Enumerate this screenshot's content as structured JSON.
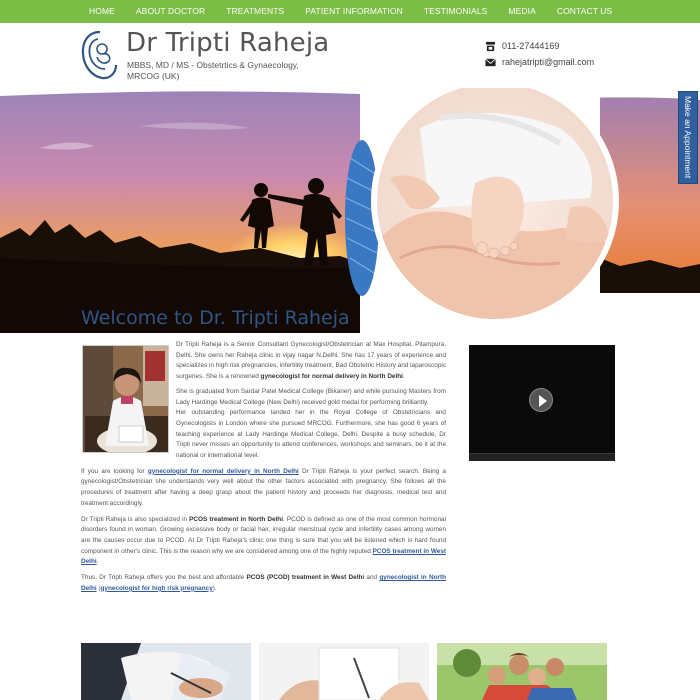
{
  "nav": {
    "items": [
      "HOME",
      "ABOUT DOCTOR",
      "TREATMENTS",
      "PATIENT INFORMATION",
      "TESTIMONIALS",
      "MEDIA",
      "CONTACT US"
    ]
  },
  "header": {
    "name": "Dr Tripti Raheja",
    "qualifications": "MBBS, MD / MS - Obstetrtics & Gynaecology, MRCOG (UK)",
    "phone": "011-27444169",
    "email": "rahejatripti@gmail.com"
  },
  "appointment_tab": "Make an Appointment",
  "main": {
    "title": "Welcome to Dr. Tripti Raheja",
    "p1_a": "Dr Tripti Raheja is a Senior Consultant Gynecologist/Obstetrician at Max Hospital, Pitampura, Delhi. She owns her Raheja clinic in vijay nagar N.Delhi. She has 17 years of experience and specializes in high risk pregnancies, infertility treatment, Bad Obstetric History and laparoscopic surgeries. She is a renowned ",
    "p1_bold": "gynecologist for normal delivery in North Delhi",
    "p1_b": ".",
    "p2": "She is graduated from Sardar Patel Medical College (Bikaner) and while pursuing Masters from Lady Hardinge Medical College (New Delhi) received gold medal for performing brilliantly.",
    "p3": "Her outstanding performance landed her in the Royal College of Obstetricians and Gynecologists in London where she pursued MRCOG. Furthermore, she has good 6 years of teaching experience at Lady Hardinge Medical College, Delhi. Despite a busy schedule, Dr Tripti never misses an opportunity to attend conferences, workshops and seminars, be it at the national or international level.",
    "p4_a": "If you are looking for ",
    "p4_link": "gynecologist for normal delivery in North Delhi",
    "p4_b": " Dr Tripti Raheja is your perfect search. Being a gynecologist/Obstetrician she understands very well about the other factors associated with pregnancy. She follows all the procedures of treatment after having a deep grasp about the patient history and proceeds her diagnosis, medical test and treatment accordingly.",
    "p5_a": "Dr Tripti Raheja is also specialized in ",
    "p5_bold": "PCOS treatment in North Delhi",
    "p5_b": ". PCOD is defined as one of the most common hormonal disorders found in woman. Growing excessive body or facial hair, irregular menstrual cycle and infertility cases among women are the causes occur due to PCOD. At Dr Tripti Raheja's clinic one thing is sure that you will be listened which is hard found component in other's clinic. This is the reason why we are considered among one of the highly reputed ",
    "p5_link": "PCOS treatment in West Delhi",
    "p5_c": ".",
    "p6_a": "Thus, Dr Tripti Raheja offers you the best and affordable ",
    "p6_bold": "PCOS (PCOD) treatment in West Delhi",
    "p6_b": " and ",
    "p6_link1": "gynecologist in North Delhi",
    "p6_c": " (",
    "p6_link2": "gynecologist for high risk pregnancy",
    "p6_d": ")."
  },
  "colors": {
    "nav_bg": "#7cbd45",
    "title_blue": "#2f5684",
    "appointment_tab": "#2f5f9e",
    "link": "#2f5a9e"
  }
}
